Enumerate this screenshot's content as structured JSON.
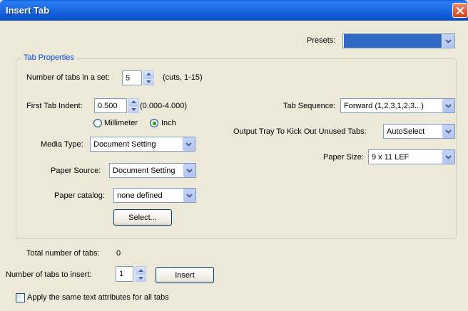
{
  "window": {
    "title": "Insert Tab"
  },
  "presets": {
    "label": "Presets:",
    "value": ""
  },
  "tab_properties": {
    "legend": "Tab Properties",
    "num_tabs_label": "Number of tabs in a set:",
    "num_tabs_value": "5",
    "num_tabs_range": "(cuts, 1-15)",
    "first_indent_label": "First Tab Indent:",
    "first_indent_value": "0.500",
    "first_indent_range": "(0.000-4.000)",
    "unit_millimeter": "Millimeter",
    "unit_inch": "Inch",
    "unit_selected": "Inch",
    "media_type_label": "Media Type:",
    "media_type_value": "Document Setting",
    "paper_source_label": "Paper Source:",
    "paper_source_value": "Document Setting",
    "paper_catalog_label": "Paper catalog:",
    "paper_catalog_value": "none defined",
    "select_button": "Select...",
    "tab_sequence_label": "Tab Sequence:",
    "tab_sequence_value": "Forward (1,2,3,1,2,3...)",
    "output_tray_label": "Output Tray To Kick Out Unused Tabs:",
    "output_tray_value": "AutoSelect",
    "paper_size_label": "Paper Size:",
    "paper_size_value": "9 x 11 LEF"
  },
  "totals": {
    "total_label": "Total number of tabs:",
    "total_value": "0",
    "insert_count_label": "Number of tabs to insert:",
    "insert_count_value": "1",
    "insert_button": "Insert",
    "apply_same_attrs_label": "Apply the same text attributes for all tabs",
    "apply_same_attrs_checked": false
  },
  "colors": {
    "title_bar": "#0a5fd8",
    "accent_legend": "#0046d5",
    "presets_selection": "#316ac5",
    "radio_dot": "#21a121"
  }
}
